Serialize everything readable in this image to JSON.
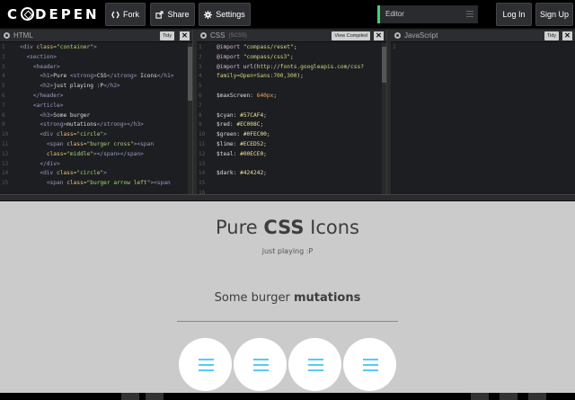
{
  "brand": {
    "name": "C O D E P E N",
    "left_letter": "C",
    "right_letters": "DEPEN"
  },
  "toolbar": {
    "fork_label": "Fork",
    "share_label": "Share",
    "settings_label": "Settings"
  },
  "view_select": {
    "value": "Editor"
  },
  "account": {
    "login_label": "Log In",
    "signup_label": "Sign Up"
  },
  "editors": {
    "html": {
      "title": "HTML",
      "tidy_label": "Tidy"
    },
    "css": {
      "title": "CSS",
      "subtitle": "(SCSS)",
      "view_compiled_label": "View Compiled"
    },
    "js": {
      "title": "JavaScript",
      "tidy_label": "Tidy"
    }
  },
  "html_gutter": [
    "1",
    "2",
    "3",
    "4",
    "5",
    "6",
    "7",
    "8",
    "9",
    "10",
    "11",
    "12",
    "13",
    "14",
    "15"
  ],
  "css_gutter": [
    "1",
    "2",
    "3",
    "4",
    "5",
    "6",
    "7",
    "8",
    "9",
    "10",
    "11",
    "12",
    "13",
    "14",
    "15",
    "16",
    "17"
  ],
  "js_gutter": [
    "1"
  ],
  "preview": {
    "title_plain": "Pure ",
    "title_bold": "CSS",
    "title_after": " Icons",
    "subtitle": "just playing :P",
    "section_plain": "Some burger ",
    "section_bold": "mutations"
  },
  "colors": {
    "cyan": "#57CAF4",
    "red": "#EC008C",
    "green": "#0FEC00",
    "lime": "#ECED52",
    "teal": "#00ECE0",
    "dark": "#424242"
  }
}
